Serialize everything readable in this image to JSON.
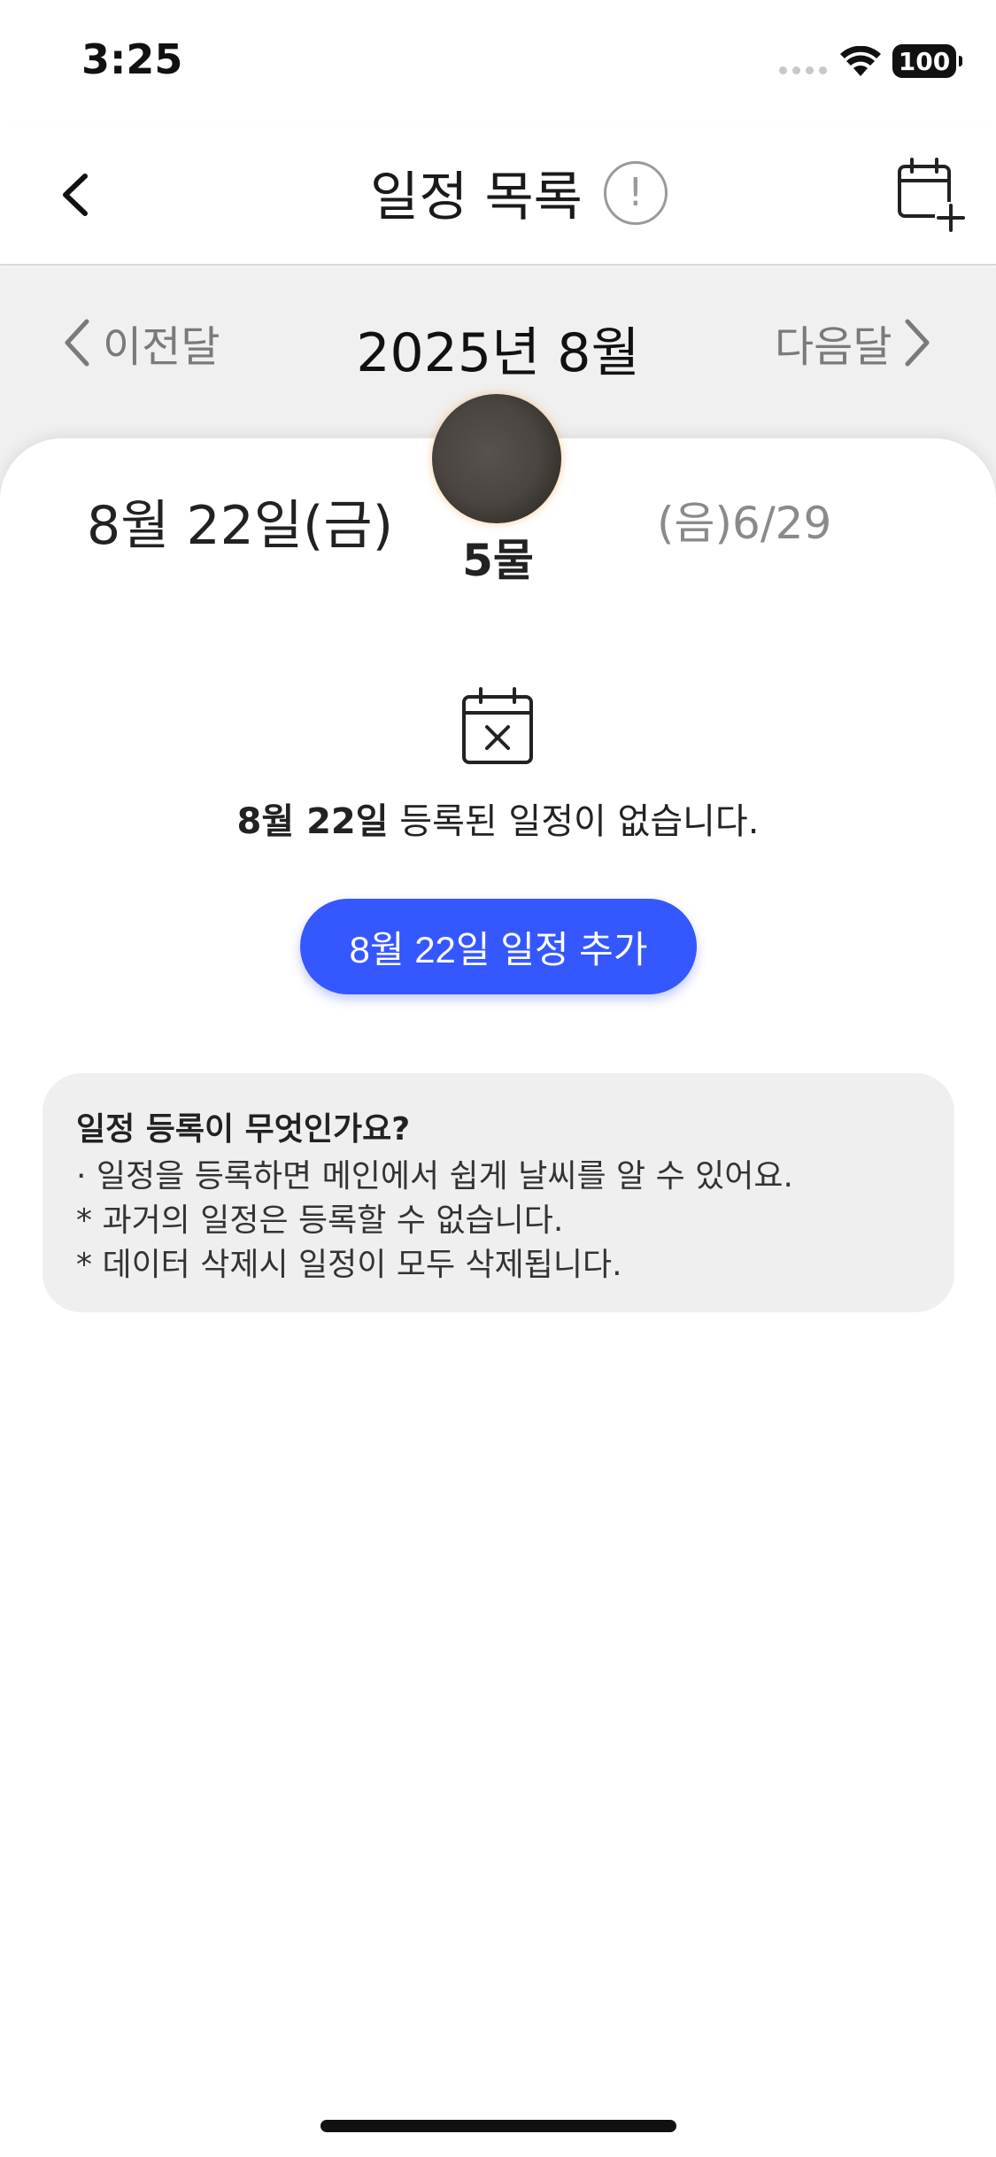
{
  "status_bar": {
    "time": "3:25",
    "battery": "100"
  },
  "header": {
    "title": "일정 목록",
    "info": "!"
  },
  "calendar": {
    "prev_label": "이전달",
    "next_label": "다음달",
    "month_title": "2025년 8월"
  },
  "sheet": {
    "date": "8월 22일(금)",
    "lunar": "(음)6/29",
    "moon_label": "5물",
    "empty_date": "8월 22일",
    "empty_text": " 등록된 일정이 없습니다.",
    "add_button": "8월 22일 일정 추가"
  },
  "info_box": {
    "title": "일정 등록이 무엇인가요?",
    "lines": [
      "· 일정을 등록하면 메인에서 쉽게 날씨를 알 수 있어요.",
      " * 과거의 일정은 등록할 수 없습니다.",
      " * 데이터 삭제시 일정이 모두 삭제됩니다."
    ]
  },
  "colors": {
    "accent": "#3457ff",
    "sunday": "#e53935",
    "saturday": "#1e88e5"
  }
}
